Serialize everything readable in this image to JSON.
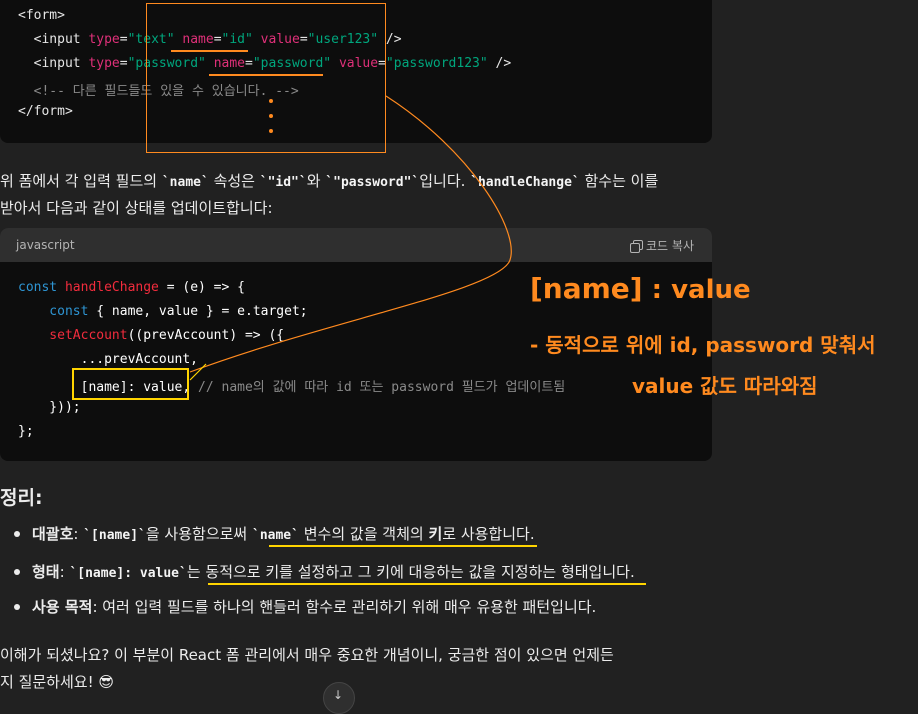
{
  "code1": {
    "lines": [
      [
        {
          "t": "<form>",
          "c": "t-tag"
        }
      ],
      [
        {
          "t": "  <input ",
          "c": "t-tag"
        },
        {
          "t": "type",
          "c": "t-attr"
        },
        {
          "t": "=",
          "c": "t-tag"
        },
        {
          "t": "\"text\"",
          "c": "t-val"
        },
        {
          "t": " ",
          "c": "t-tag"
        },
        {
          "t": "name",
          "c": "t-attr"
        },
        {
          "t": "=",
          "c": "t-tag"
        },
        {
          "t": "\"id\"",
          "c": "t-val"
        },
        {
          "t": " ",
          "c": "t-tag"
        },
        {
          "t": "value",
          "c": "t-attr"
        },
        {
          "t": "=",
          "c": "t-tag"
        },
        {
          "t": "\"user123\"",
          "c": "t-val"
        },
        {
          "t": " />",
          "c": "t-tag"
        }
      ],
      [
        {
          "t": "  <input ",
          "c": "t-tag"
        },
        {
          "t": "type",
          "c": "t-attr"
        },
        {
          "t": "=",
          "c": "t-tag"
        },
        {
          "t": "\"password\"",
          "c": "t-val"
        },
        {
          "t": " ",
          "c": "t-tag"
        },
        {
          "t": "name",
          "c": "t-attr"
        },
        {
          "t": "=",
          "c": "t-tag"
        },
        {
          "t": "\"password\"",
          "c": "t-val"
        },
        {
          "t": " ",
          "c": "t-tag"
        },
        {
          "t": "value",
          "c": "t-attr"
        },
        {
          "t": "=",
          "c": "t-tag"
        },
        {
          "t": "\"password123\"",
          "c": "t-val"
        },
        {
          "t": " />",
          "c": "t-tag"
        }
      ],
      [
        {
          "t": "  <!-- 다른 필드들도 있을 수 있습니다. -->",
          "c": "t-com"
        }
      ],
      [
        {
          "t": "</form>",
          "c": "t-tag"
        }
      ]
    ]
  },
  "para1": {
    "p1": "위 폼에서 각 입력 필드의 ",
    "c1": "`name`",
    "p2": " 속성은 ",
    "c2": "`\"id\"`",
    "p3": "와 ",
    "c3": "`\"password\"`",
    "p4": "입니다. ",
    "c4": "`handleChange`",
    "p5": " 함수는 이를",
    "line2": "받아서 다음과 같이 상태를 업데이트합니다:"
  },
  "code2": {
    "lang": "javascript",
    "copy_label": "코드 복사",
    "lines": [
      [
        {
          "t": "const ",
          "c": "t-kw"
        },
        {
          "t": "handleChange",
          "c": "t-fn"
        },
        {
          "t": " = (e) => {",
          "c": "t-plain"
        }
      ],
      [
        {
          "t": "    const ",
          "c": "t-kw"
        },
        {
          "t": "{ name, value } = e.target;",
          "c": "t-plain"
        }
      ],
      [
        {
          "t": "    setAccount",
          "c": "t-fn"
        },
        {
          "t": "((prevAccount) => ({",
          "c": "t-plain"
        }
      ],
      [
        {
          "t": "        ...prevAccount,",
          "c": "t-plain"
        }
      ],
      [
        {
          "t": "        [name]: value, ",
          "c": "t-plain"
        },
        {
          "t": "// name의 값에 따라 id 또는 password 필드가 업데이트됨",
          "c": "t-com"
        }
      ],
      [
        {
          "t": "    }));",
          "c": "t-plain"
        }
      ],
      [
        {
          "t": "};",
          "c": "t-plain"
        }
      ]
    ]
  },
  "annotation": {
    "title_a": "[name]",
    "title_b": " : value",
    "line1": "- 동적으로 위에 id, password 맞춰서",
    "line2": "value 값도 따라와짐"
  },
  "summary": {
    "heading": "정리:",
    "items": [
      {
        "label": "대괄호",
        "rest_a": ": ",
        "code": "`[name]`",
        "rest_b": "을 사용함으로써 ",
        "code2": "`name`",
        "rest_c": " 변수의 값을 객체의 ",
        "bold": "키",
        "rest_d": "로 사용합니다."
      },
      {
        "label": "형태",
        "rest_a": ": ",
        "code": "`[name]: value`",
        "rest_b": "는 동적으로 키를 설정하고 그 키에 대응하는 값을 지정하는 형태입니다."
      },
      {
        "label": "사용 목적",
        "rest_a": ": 여러 입력 필드를 하나의 핸들러 함수로 관리하기 위해 매우 유용한 패턴입니다."
      }
    ]
  },
  "footer": {
    "line1": "이해가 되셨나요? 이 부분이 React 폼 관리에서 매우 중요한 개념이니, 궁금한 점이 있으면 언제든",
    "line2": "지 질문하세요! 😎"
  },
  "colors": {
    "annotation_orange": "#ff8a1f",
    "highlight_yellow": "#ffd400",
    "bg": "#212121",
    "code_bg": "#0d0d0d"
  }
}
